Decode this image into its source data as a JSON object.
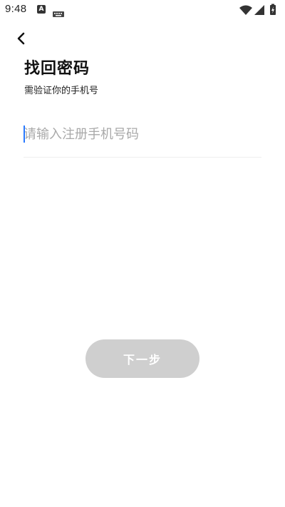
{
  "status_bar": {
    "time": "9:48",
    "icons": [
      "a-notification-icon",
      "keyboard-icon",
      "wifi-icon",
      "signal-icon",
      "battery-charging-icon"
    ]
  },
  "header": {
    "back_icon": "chevron-left-icon",
    "title": "找回密码",
    "subtitle": "需验证你的手机号"
  },
  "form": {
    "phone_value": "",
    "phone_placeholder": "请输入注册手机号码"
  },
  "actions": {
    "next_label": "下一步"
  },
  "colors": {
    "disabled_button": "#cfcfcf",
    "caret": "#2979ff",
    "placeholder": "#a9a9a9",
    "divider": "#eeeeee"
  }
}
